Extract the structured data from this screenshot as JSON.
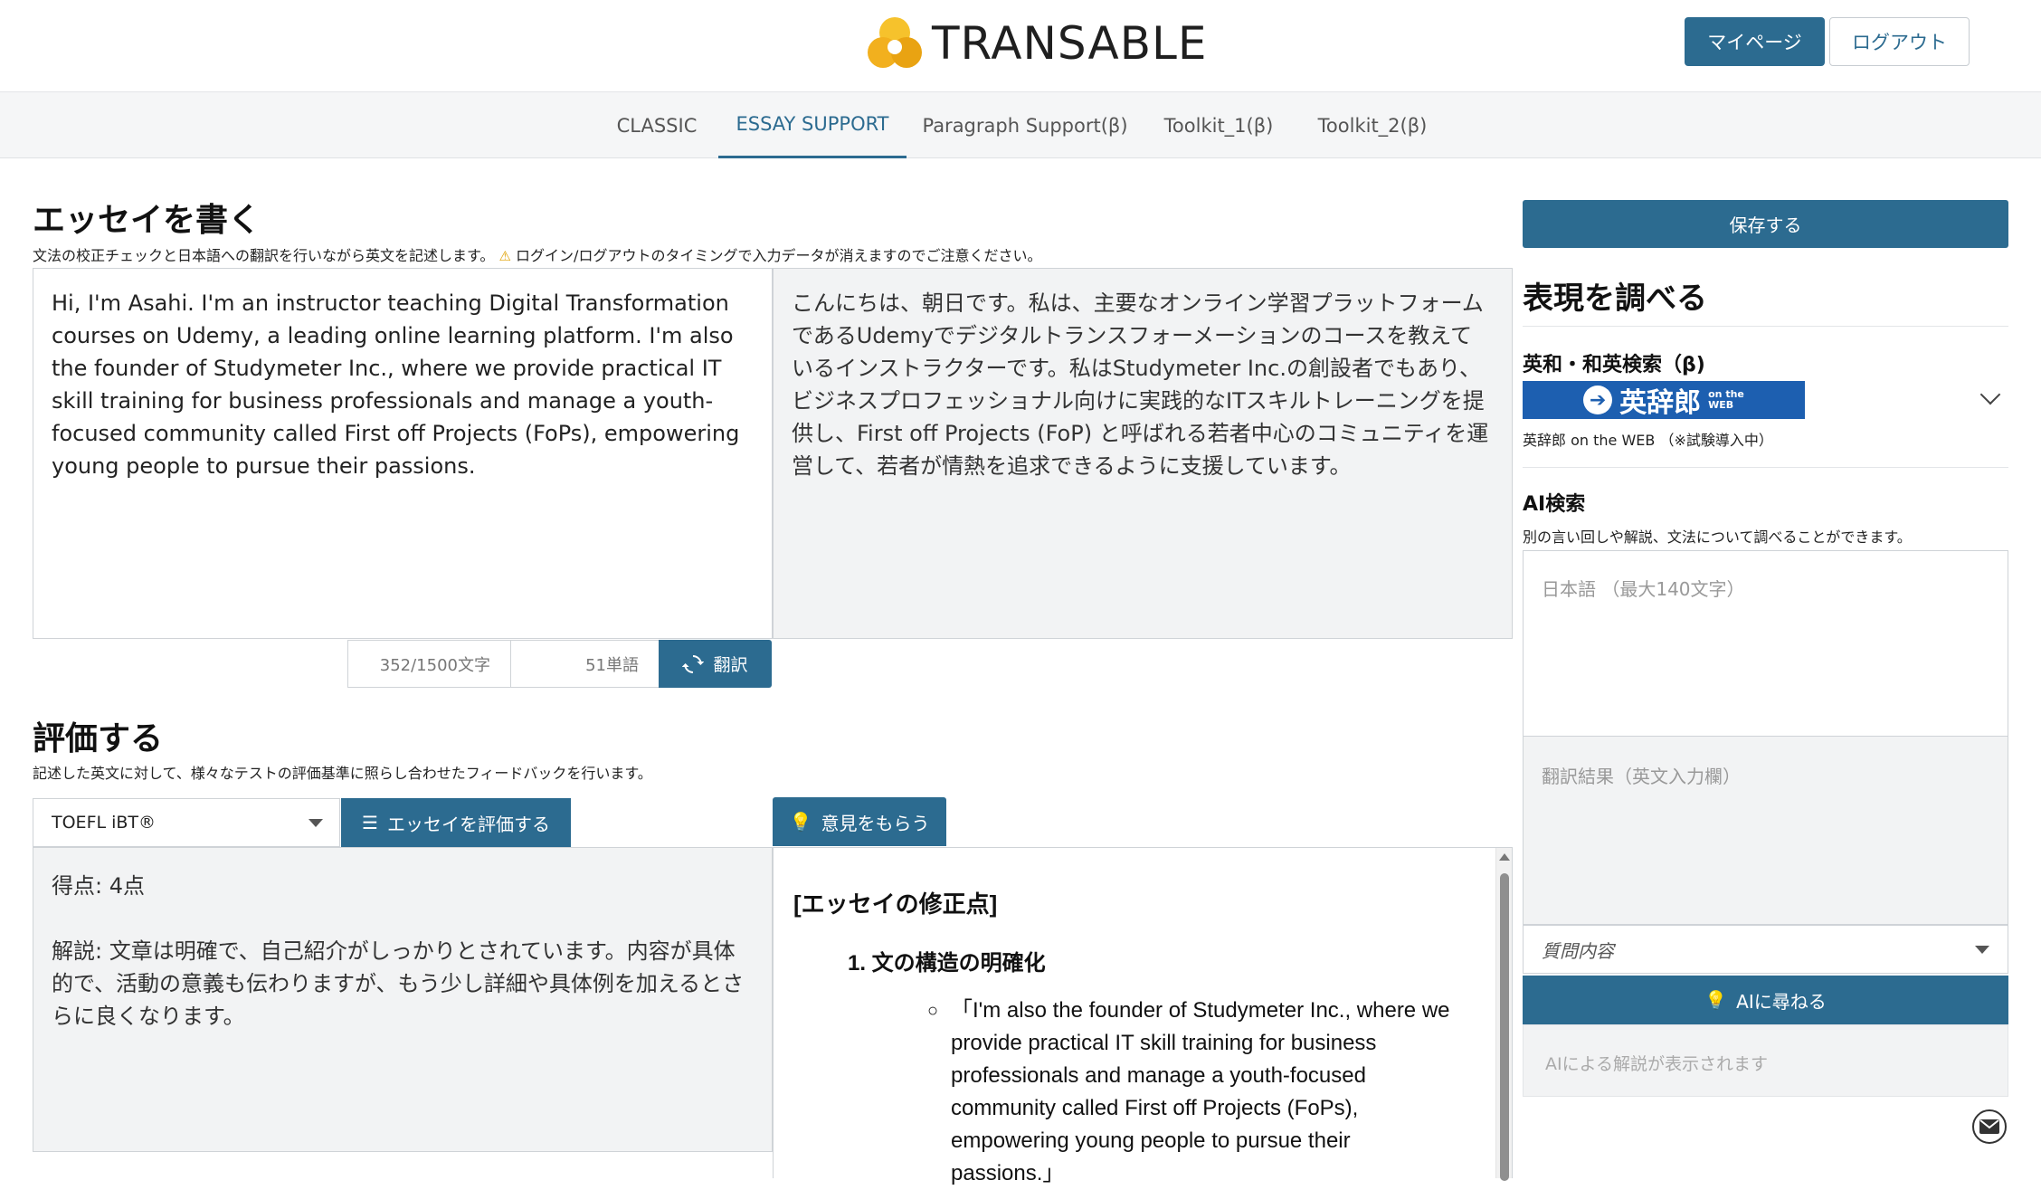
{
  "header": {
    "brand": "TRANSABLE",
    "mypage_label": "マイページ",
    "logout_label": "ログアウト"
  },
  "tabs": [
    {
      "label": "CLASSIC",
      "active": false
    },
    {
      "label": "ESSAY SUPPORT",
      "active": true
    },
    {
      "label": "Paragraph Support(β)",
      "active": false
    },
    {
      "label": "Toolkit_1(β)",
      "active": false
    },
    {
      "label": "Toolkit_2(β)",
      "active": false
    }
  ],
  "write": {
    "title": "エッセイを書く",
    "description": "文法の校正チェックと日本語への翻訳を行いながら英文を記述します。",
    "warning": "ログイン/ログアウトのタイミングで入力データが消えますのでご注意ください。",
    "essay_text": "Hi, I'm Asahi. I'm an instructor teaching Digital Transformation courses on Udemy, a leading online learning platform. I'm also the founder of Studymeter Inc., where we provide practical IT skill training for business professionals and manage a youth-focused community called First off Projects (FoPs), empowering young people to pursue their passions.",
    "translation_text": "こんにちは、朝日です。私は、主要なオンライン学習プラットフォームであるUdemyでデジタルトランスフォーメーションのコースを教えているインストラクターです。私はStudymeter Inc.の創設者でもあり、ビジネスプロフェッショナル向けに実践的なITスキルトレーニングを提供し、First off Projects (FoP) と呼ばれる若者中心のコミュニティを運営して、若者が情熱を追求できるように支援しています。",
    "char_count": "352/1500文字",
    "word_count": "51単語",
    "translate_label": "翻訳"
  },
  "evaluate": {
    "title": "評価する",
    "description": "記述した英文に対して、様々なテストの評価基準に照らし合わせたフィードバックを行います。",
    "test_selected": "TOEFL iBT®",
    "evaluate_label": "エッセイを評価する",
    "opinion_label": "意見をもらう",
    "score": "得点: 4点",
    "explanation": "解説: 文章は明確で、自己紹介がしっかりとされています。内容が具体的で、活動の意義も伝わりますが、もう少し詳細や具体例を加えるとさらに良くなります。",
    "feedback_heading": "[エッセイの修正点]",
    "feedback_item": "1. 文の構造の明確化",
    "feedback_quote": "「I'm also the founder of Studymeter Inc., where we provide practical IT skill training for business professionals and manage a youth-focused community called First off Projects (FoPs), empowering young people to pursue their passions.」"
  },
  "sidebar": {
    "save_label": "保存する",
    "lookup_title": "表現を調べる",
    "dict_title": "英和・和英検索（β)",
    "dict_logo": "英辞郎",
    "dict_logo_small_top": "on the",
    "dict_logo_small_bottom": "WEB",
    "dict_caption": "英辞郎 on the WEB （※試験導入中）",
    "ai_title": "AI検索",
    "ai_description": "別の言い回しや解説、文法について調べることができます。",
    "ai_input_placeholder": "日本語 （最大140文字）",
    "ai_output_placeholder": "翻訳結果（英文入力欄）",
    "question_placeholder": "質問内容",
    "ask_label": "AIに尋ねる",
    "answer_placeholder": "AIによる解説が表示されます"
  },
  "colors": {
    "primary": "#2c6b90",
    "logo_yellow": "#f2b01e",
    "dict_blue": "#1d5fb0"
  }
}
